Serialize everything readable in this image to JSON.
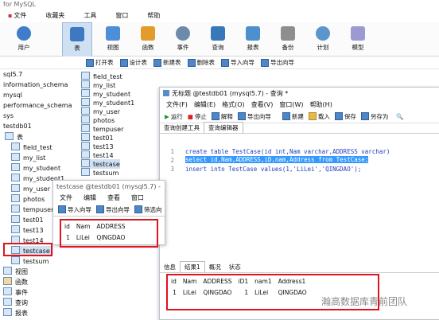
{
  "app": {
    "title": "for MySQL",
    "menu": [
      "文件",
      "收藏夹",
      "工具",
      "窗口",
      "帮助"
    ],
    "ribbon": [
      {
        "label": "用户",
        "color": "#3f7cc9"
      },
      {
        "label": "表",
        "color": "#3e78c2"
      },
      {
        "label": "视图",
        "color": "#4d8ed8"
      },
      {
        "label": "函数",
        "color": "#e39b2b"
      },
      {
        "label": "事件",
        "color": "#6d8aa8"
      },
      {
        "label": "查询",
        "color": "#3878b8"
      },
      {
        "label": "报表",
        "color": "#4e8fce"
      },
      {
        "label": "备份",
        "color": "#8e8e8e"
      },
      {
        "label": "计划",
        "color": "#5c95cc"
      },
      {
        "label": "模型",
        "color": "#9b9bd1"
      }
    ],
    "subtoolbar": [
      "打开表",
      "设计表",
      "新建表",
      "删除表",
      "导入向导",
      "导出向导"
    ]
  },
  "nav": {
    "rows": [
      "sql5.7",
      "information_schema",
      "mysql",
      "performance_schema",
      "sys",
      "testdb01",
      "表",
      "field_test",
      "my_list",
      "my_student",
      "my_student1",
      "my_user",
      "photos",
      "tempuser",
      "test01",
      "test13",
      "test14",
      "testcase",
      "testsum",
      "视图",
      "函数",
      "事件",
      "查询",
      "报表"
    ]
  },
  "objlist": [
    "field_test",
    "my_list",
    "my_student",
    "my_student1",
    "my_user",
    "photos",
    "tempuser",
    "test01",
    "test13",
    "test14",
    "testcase",
    "testsum"
  ],
  "query": {
    "title": "无标题 @testdb01 (mysql5.7) - 查询 *",
    "menu": [
      "文件(F)",
      "编辑(E)",
      "格式(O)",
      "查看(V)",
      "窗口(W)",
      "帮助(H)"
    ],
    "tools": [
      "运行",
      "停止",
      "解释",
      "导出向导",
      "新建",
      "载入",
      "保存",
      "另存为"
    ],
    "tabs": [
      "查询创建工具",
      "查询编辑器"
    ],
    "lines": [
      "create table TestCase(id int,Nam varchar,ADDRESS varchar)",
      "select id,Nam,ADDRESS,iD,nam,Address from TestCase;",
      "insert into TestCase values(1,'LiLei','QINGDAO');"
    ],
    "result_tabs": [
      "信息",
      "结果1",
      "概况",
      "状态"
    ],
    "result_headers": [
      "id",
      "Nam",
      "ADDRESS",
      "iD1",
      "nam1",
      "Address1"
    ],
    "result_row": [
      "1",
      "LiLei",
      "QINGDAO",
      "1",
      "LiLei",
      "QINGDAO"
    ]
  },
  "tablewin": {
    "title": "testcase @testdb01 (mysql5.7) -",
    "menu": [
      "文件",
      "编辑",
      "查看",
      "窗口"
    ],
    "tools": [
      "导入向导",
      "导出向导",
      "筛选向"
    ],
    "headers": [
      "id",
      "Nam",
      "ADDRESS"
    ],
    "row": [
      "1",
      "LiLei",
      "QINGDAO"
    ]
  },
  "watermark": "瀚高数据库青前团队"
}
